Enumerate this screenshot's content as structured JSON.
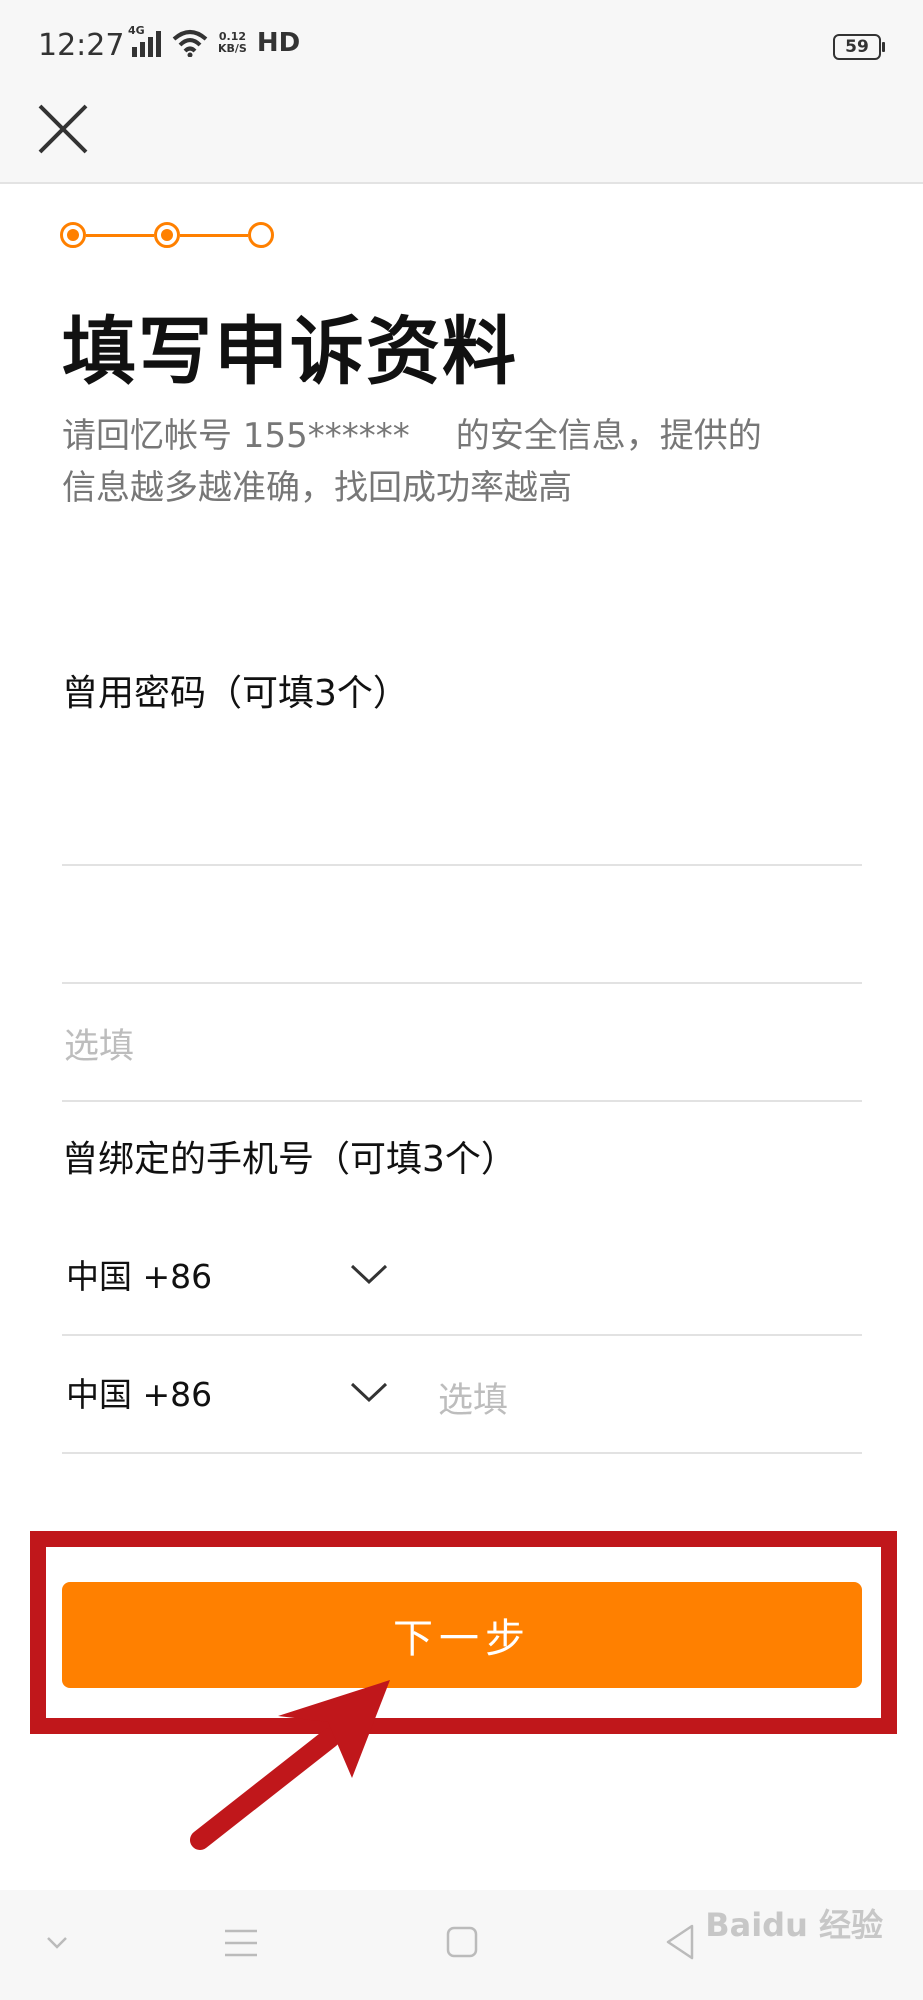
{
  "status_bar": {
    "time": "12:27",
    "network": "4G",
    "speed_value": "0.12",
    "speed_unit": "KB/S",
    "hd": "HD",
    "battery": "59"
  },
  "header": {
    "close_icon": "close-icon"
  },
  "steps": {
    "total": 3,
    "current": 2,
    "accent": "#ff8000"
  },
  "page": {
    "title": "填写申诉资料",
    "desc_part1": "请回忆帐号 155******",
    "desc_part2": "的安全信息，提供的",
    "desc_line2": "信息越多越准确，找回成功率越高"
  },
  "passwords": {
    "label": "曾用密码（可填3个）",
    "placeholder": "选填"
  },
  "phones": {
    "label": "曾绑定的手机号（可填3个）",
    "rows": [
      {
        "country": "中国 +86",
        "placeholder": ""
      },
      {
        "country": "中国 +86",
        "placeholder": "选填"
      }
    ]
  },
  "next_button": {
    "label": "下一步",
    "color": "#ff8000"
  },
  "annotation": {
    "color": "#c0171b"
  },
  "watermark": {
    "text": "Baidu 经验"
  }
}
